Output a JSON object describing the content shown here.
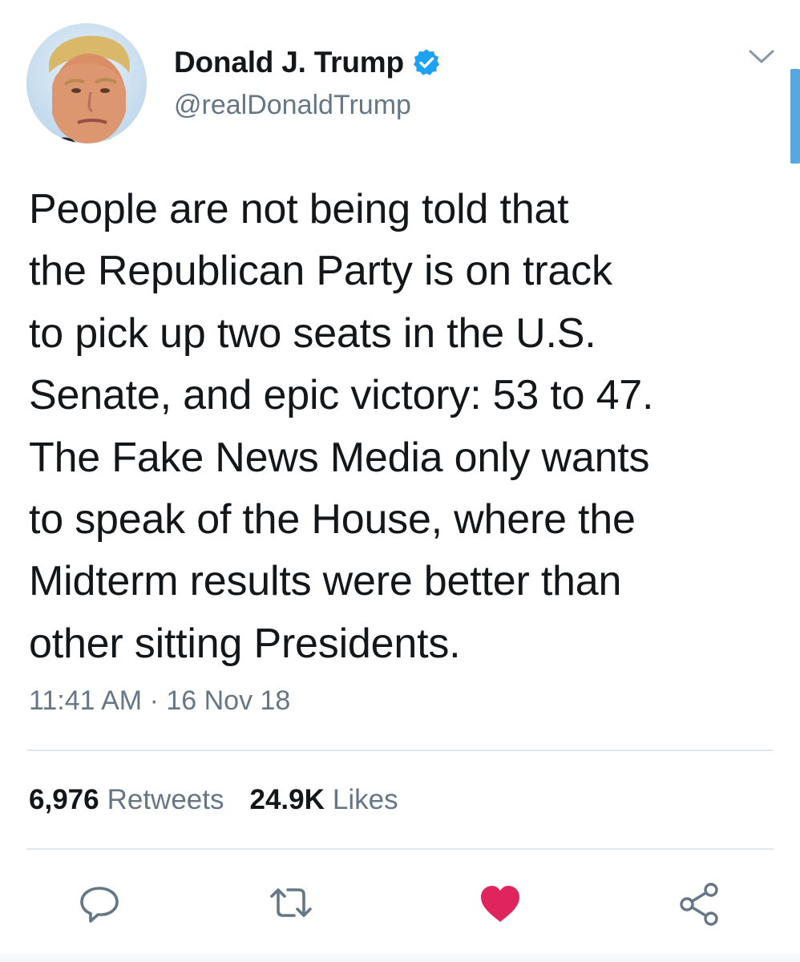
{
  "author": {
    "display_name": "Donald J. Trump",
    "handle": "@realDonaldTrump",
    "verified": true
  },
  "tweet": {
    "text_lines": [
      "People are not being told that",
      "the Republican Party is on track",
      "to pick up two seats in the U.S.",
      "Senate, and epic victory: 53 to 47.",
      "The Fake News Media only wants",
      "to speak of the House, where the",
      "Midterm results were better than",
      "other sitting Presidents."
    ],
    "timestamp": "11:41 AM · 16 Nov 18"
  },
  "stats": {
    "retweets_count": "6,976",
    "retweets_label": "Retweets",
    "likes_count": "24.9K",
    "likes_label": "Likes"
  },
  "actions": {
    "reply_icon": "reply-icon",
    "retweet_icon": "retweet-icon",
    "like_icon": "heart-icon",
    "like_state": "liked",
    "share_icon": "share-icon"
  },
  "colors": {
    "verified_blue": "#1da1f2",
    "text_primary": "#14171a",
    "text_secondary": "#657786",
    "like_red": "#e0245e",
    "divider": "#e1e8ed",
    "scroll_indicator": "#5aa6e0"
  }
}
